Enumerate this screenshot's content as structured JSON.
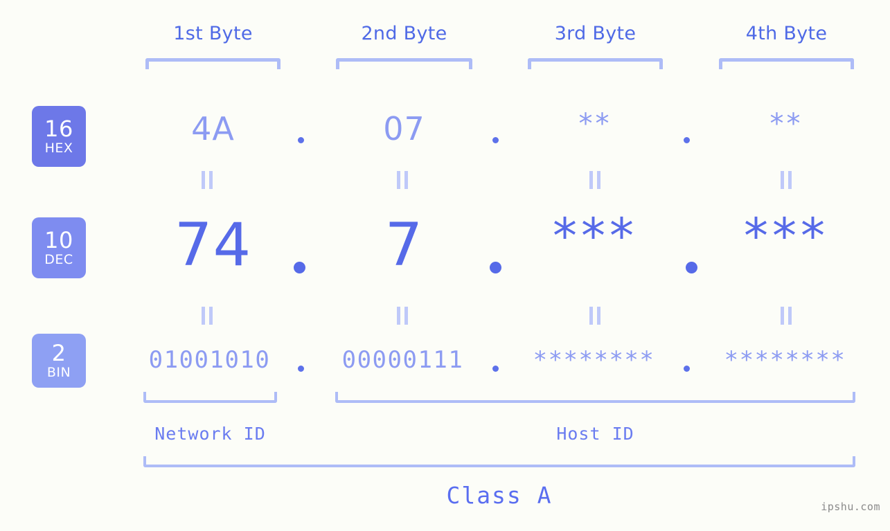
{
  "page": {
    "background_color": "#fcfdf8",
    "accent_color": "#566ae8",
    "accent_light_color": "#8c9bf2",
    "bracket_color": "#aebcf7"
  },
  "headers": [
    {
      "label": "1st Byte"
    },
    {
      "label": "2nd Byte"
    },
    {
      "label": "3rd Byte"
    },
    {
      "label": "4th Byte"
    }
  ],
  "bases": [
    {
      "number": "16",
      "name": "HEX",
      "color": "#6d78e8"
    },
    {
      "number": "10",
      "name": "DEC",
      "color": "#7e8cf0"
    },
    {
      "number": "2",
      "name": "BIN",
      "color": "#8ea0f3"
    }
  ],
  "rows": {
    "hex": {
      "base_number": "16",
      "base_name": "HEX",
      "values": [
        "4A",
        "07",
        "**",
        "**"
      ],
      "separator": "."
    },
    "dec": {
      "base_number": "10",
      "base_name": "DEC",
      "values": [
        "74",
        "7",
        "***",
        "***"
      ],
      "separator": "."
    },
    "bin": {
      "base_number": "2",
      "base_name": "BIN",
      "values": [
        "01001010",
        "00000111",
        "********",
        "********"
      ],
      "separator": "."
    }
  },
  "equal_marks": {
    "symbol": "="
  },
  "sections": [
    {
      "label": "Network ID"
    },
    {
      "label": "Host ID"
    }
  ],
  "class": {
    "label": "Class A"
  },
  "watermark": {
    "text": "ipshu.com"
  }
}
